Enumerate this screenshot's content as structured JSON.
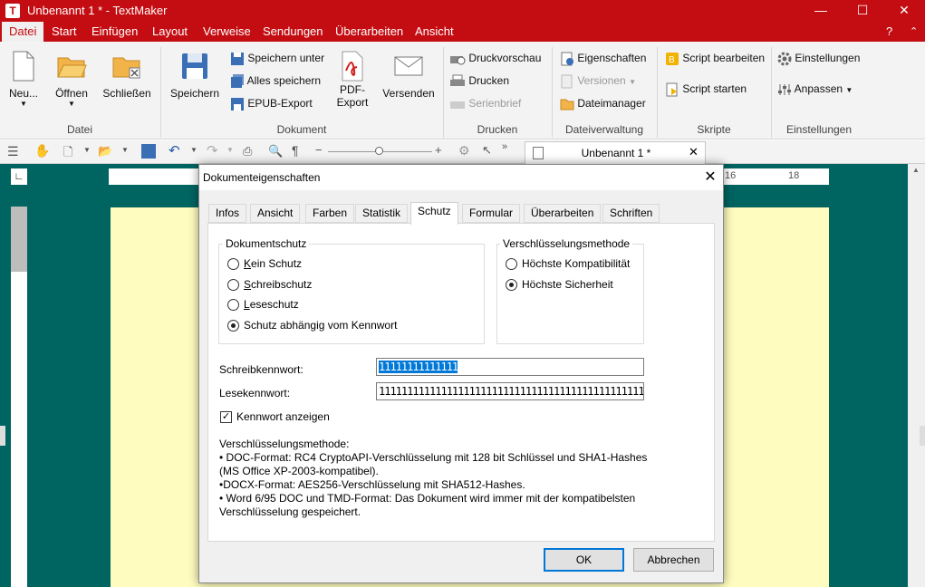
{
  "window": {
    "title": "Unbenannt 1 * - TextMaker",
    "app_icon": "T",
    "help": "?"
  },
  "menu": [
    "Datei",
    "Start",
    "Einfügen",
    "Layout",
    "Verweise",
    "Sendungen",
    "Überarbeiten",
    "Ansicht"
  ],
  "ribbon": {
    "datei": {
      "label": "Datei",
      "neu": "Neu...",
      "oeffnen": "Öffnen",
      "schliessen": "Schließen"
    },
    "dokument": {
      "label": "Dokument",
      "speichern": "Speichern",
      "speichern_unter": "Speichern unter",
      "alles_speichern": "Alles speichern",
      "epub": "EPUB-Export",
      "pdf_1": "PDF-",
      "pdf_2": "Export",
      "versenden": "Versenden"
    },
    "drucken": {
      "label": "Drucken",
      "druckvorschau": "Druckvorschau",
      "drucken": "Drucken",
      "serienbrief": "Serienbrief"
    },
    "dateiverwaltung": {
      "label": "Dateiverwaltung",
      "eigenschaften": "Eigenschaften",
      "versionen": "Versionen",
      "dateimanager": "Dateimanager"
    },
    "skripte": {
      "label": "Skripte",
      "bearbeiten": "Script bearbeiten",
      "starten": "Script starten"
    },
    "einstellungen": {
      "label": "Einstellungen",
      "einstellungen": "Einstellungen",
      "anpassen": "Anpassen"
    }
  },
  "doc_tab": {
    "title": "Unbenannt 1 *"
  },
  "ruler": {
    "h_right_1": "16",
    "h_right_2": "18"
  },
  "dialog": {
    "title": "Dokumenteigenschaften",
    "tabs": [
      "Infos",
      "Ansicht",
      "Farben",
      "Statistik",
      "Schutz",
      "Formular",
      "Überarbeiten",
      "Schriften"
    ],
    "active_tab": "Schutz",
    "dokumentschutz": {
      "title": "Dokumentschutz",
      "options": [
        "Kein Schutz",
        "Schreibschutz",
        "Leseschutz",
        "Schutz abhängig vom Kennwort"
      ],
      "selected": 3
    },
    "verschluesselung": {
      "title": "Verschlüsselungsmethode",
      "options": [
        "Höchste Kompatibilität",
        "Höchste Sicherheit"
      ],
      "selected": 1
    },
    "schreibkennwort_label": "Schreibkennwort:",
    "schreibkennwort_value": "11111111111111",
    "lesekennwort_label": "Lesekennwort:",
    "lesekennwort_value": "11111111111111111111111111111111111111111111111",
    "kennwort_anzeigen": {
      "label": "Kennwort anzeigen",
      "checked": true
    },
    "info_lines": [
      "Verschlüsselungsmethode:",
      "• DOC-Format: RC4 CryptoAPI-Verschlüsselung mit 128 bit Schlüssel und SHA1-Hashes",
      "(MS Office XP-2003-kompatibel).",
      "•DOCX-Format: AES256-Verschlüsselung mit SHA512-Hashes.",
      "• Word 6/95 DOC und TMD-Format: Das Dokument wird immer mit der kompatibelsten",
      "Verschlüsselung gespeichert."
    ],
    "ok": "OK",
    "cancel": "Abbrechen"
  },
  "colors": {
    "brand": "#c40d12",
    "workspace": "#006460",
    "page": "#fefcbe",
    "selection": "#0078d7"
  }
}
